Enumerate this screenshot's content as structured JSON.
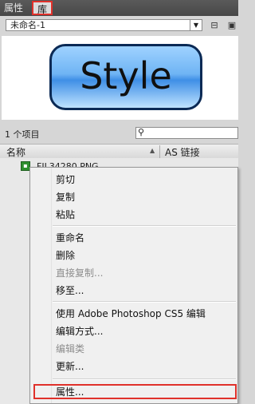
{
  "tabs": {
    "properties": "属性",
    "library": "库"
  },
  "toolbar": {
    "document": "未命名-1",
    "icons": [
      "pin-icon",
      "new-library-icon"
    ]
  },
  "preview": {
    "symbol_text": "Style"
  },
  "list": {
    "item_count": "1 个项目",
    "search_placeholder": "",
    "columns": {
      "name": "名称",
      "linkage": "AS 链接"
    },
    "items": [
      {
        "name": "FIL34280.PNG",
        "icon": "bitmap-icon"
      }
    ]
  },
  "context_menu": {
    "items": [
      {
        "label": "剪切",
        "enabled": true
      },
      {
        "label": "复制",
        "enabled": true
      },
      {
        "label": "粘贴",
        "enabled": true
      },
      {
        "label": "重命名",
        "enabled": true
      },
      {
        "label": "删除",
        "enabled": true
      },
      {
        "label": "直接复制...",
        "enabled": false
      },
      {
        "label": "移至...",
        "enabled": true
      },
      {
        "label": "使用 Adobe Photoshop CS5 编辑",
        "enabled": true
      },
      {
        "label": "编辑方式...",
        "enabled": true
      },
      {
        "label": "编辑类",
        "enabled": false
      },
      {
        "label": "更新...",
        "enabled": true
      },
      {
        "label": "属性...",
        "enabled": true
      }
    ]
  },
  "colors": {
    "highlight": "#e0312b",
    "tabbar": "#4f4f4f",
    "panel": "#d6d6d6"
  }
}
